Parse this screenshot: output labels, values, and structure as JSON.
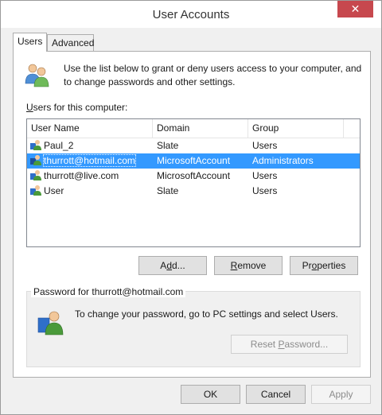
{
  "window": {
    "title": "User Accounts",
    "close_glyph": "✕"
  },
  "tabs": [
    {
      "label": "Users",
      "active": true
    },
    {
      "label": "Advanced",
      "active": false
    }
  ],
  "intro": {
    "icon": "users-icon",
    "text": "Use the list below to grant or deny users access to your computer, and to change passwords and other settings."
  },
  "users_label": {
    "accel": "U",
    "rest": "sers for this computer:"
  },
  "table": {
    "columns": [
      "User Name",
      "Domain",
      "Group"
    ],
    "rows": [
      {
        "name": "Paul_2",
        "domain": "Slate",
        "group": "Users"
      },
      {
        "name": "thurrott@hotmail.com",
        "domain": "MicrosoftAccount",
        "group": "Administrators",
        "selected": true
      },
      {
        "name": "thurrott@live.com",
        "domain": "MicrosoftAccount",
        "group": "Users"
      },
      {
        "name": "User",
        "domain": "Slate",
        "group": "Users"
      }
    ]
  },
  "buttons": {
    "add": {
      "pre": "A",
      "accel": "d",
      "post": "d..."
    },
    "remove": {
      "pre": "",
      "accel": "R",
      "post": "emove"
    },
    "properties": {
      "pre": "Pr",
      "accel": "o",
      "post": "perties"
    },
    "ok": "OK",
    "cancel": "Cancel",
    "apply": "Apply"
  },
  "password": {
    "legend": "Password for thurrott@hotmail.com",
    "icon": "user-key-icon",
    "text": "To change your password, go to PC settings and select Users.",
    "reset": {
      "pre": "Reset ",
      "accel": "P",
      "post": "assword..."
    }
  },
  "colors": {
    "selection": "#3399ff",
    "close": "#c7484e"
  }
}
